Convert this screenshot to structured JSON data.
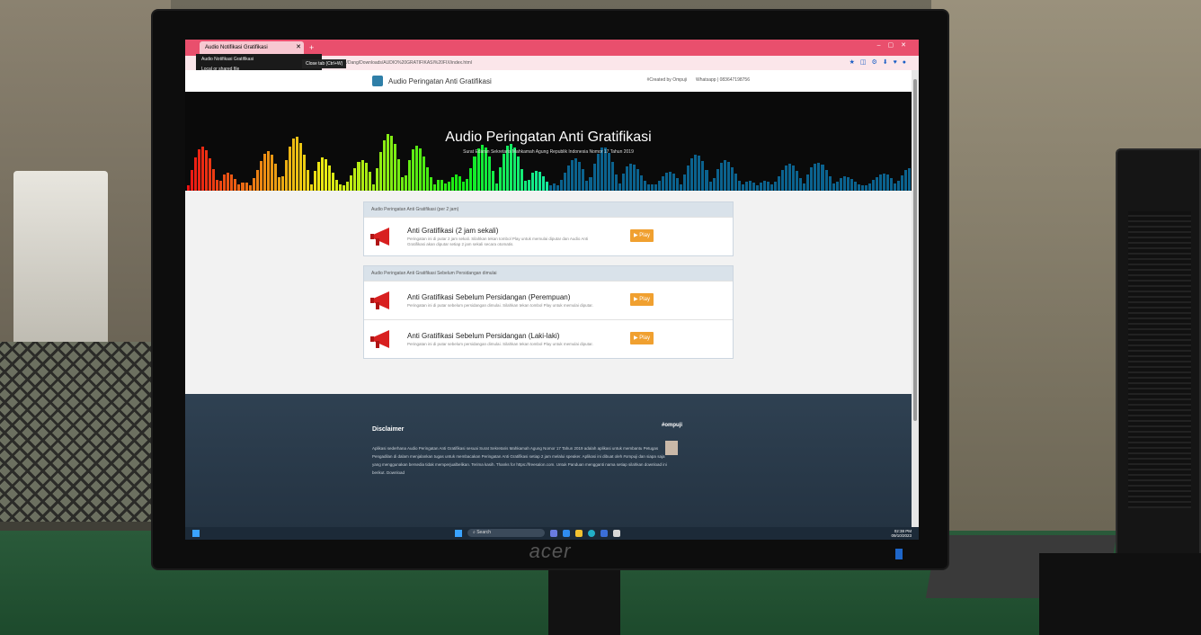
{
  "browser": {
    "tab_title": "Audio Notifikasi Gratifikasi",
    "tooltip": "Close tab (Ctrl+W)",
    "tab_preview_title": "Audio Notifikasi Gratifikasi",
    "tab_preview_source": "Local or shared file",
    "address": "C:/Users/Dang/Downloads/AUDIO%20GRATIFIKASI%20FIX/index.html"
  },
  "site": {
    "title": "Audio Peringatan Anti Gratifikasi",
    "credit": "#Created by Ompuji",
    "whatsapp": "Whatsapp | 083647198756"
  },
  "hero": {
    "title": "Audio Peringatan Anti Gratifikasi",
    "subtitle": "Surat Edaran Sekretaris Mahkamah Agung Republik Indonesia Nomor 17 Tahun 2019"
  },
  "panels": [
    {
      "heading": "Audio Peringatan Anti Gratifikasi (per 2 jam)",
      "items": [
        {
          "title": "Anti Gratifikasi (2 jam sekali)",
          "desc": "Peringatan ini di putar 2 jam sekali. Silahkan tekan tombol Play untuk memulai diputar dan Audio Anti Gratifikasi akan diputar setiap 2 jam sekali secara otomatis.",
          "button": "Play"
        }
      ]
    },
    {
      "heading": "Audio Peringatan Anti Gratifikasi Sebelum Persidangan dimulai",
      "items": [
        {
          "title": "Anti Gratifikasi Sebelum Persidangan (Perempuan)",
          "desc": "Peringatan ini di putar sebelum persidangan dimulai. Silahkan tekan tombol Play untuk memulai diputar.",
          "button": "Play"
        },
        {
          "title": "Anti Gratifikasi Sebelum Persidangan (Laki-laki)",
          "desc": "Peringatan ini di putar sebelum persidangan dimulai. Silahkan tekan tombol Play untuk memulai diputar.",
          "button": "Play"
        }
      ]
    }
  ],
  "footer": {
    "disclaimer_title": "Disclaimer",
    "disclaimer_text": "Aplikasi sederhana Audio Peringatan Anti Gratifikasi sesuai Surat Sekretaris Mahkamah Agung Nomor 17 Tahun 2019 adalah aplikasi untuk membantu Petugas Pengadilan di dalam menjalankan tugas untuk membacakan Peringatan Anti Gratifikasi setiap 2 jam melalui speaker. Aplikasi ini dibuat oleh #ompuji dan siapa saja yang menggunakan bersedia tidak memperjualbelikan. Terima kasih. Thanks for https://freesalon.com. Untuk Panduan mengganti nama setiap silahkan download ini berikut. Download",
    "author": "#ompuji"
  },
  "taskbar": {
    "search": "Search",
    "time": "02:38 PM",
    "date": "09/10/2023"
  },
  "monitor": {
    "brand": "acer"
  },
  "colors": {
    "tab": "#e94f6d",
    "play": "#f0a030",
    "footer": "#2f4152"
  }
}
